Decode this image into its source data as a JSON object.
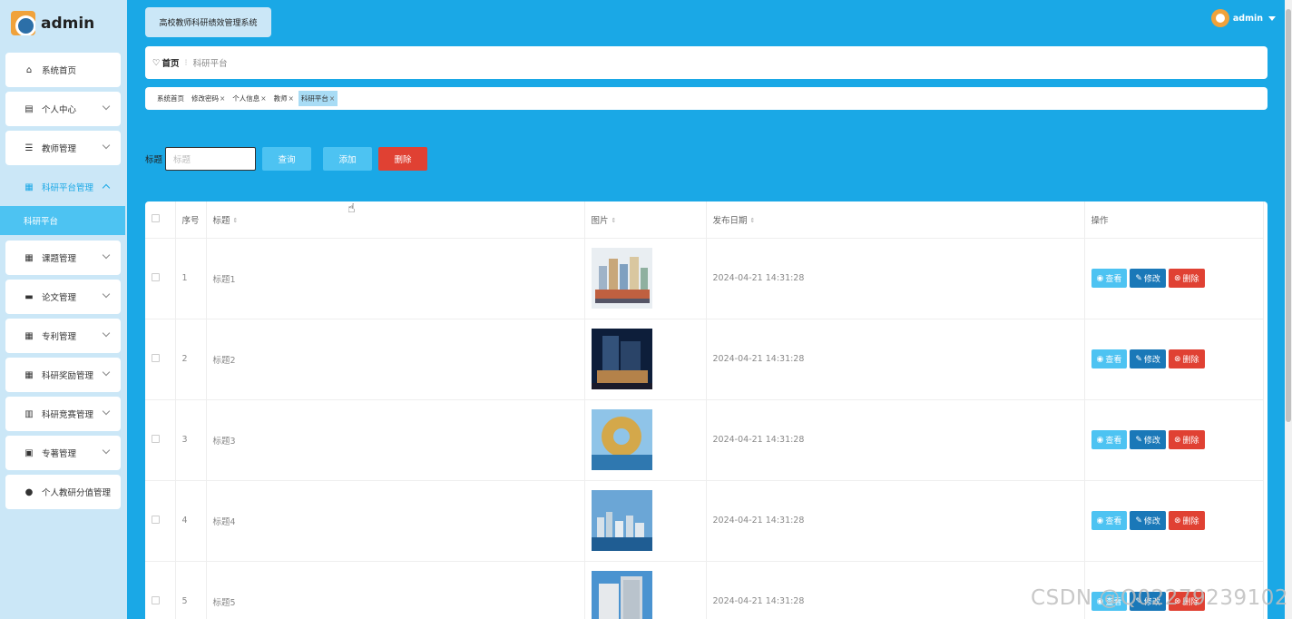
{
  "app": {
    "logo_text": "admin",
    "system_title": "高校教师科研绩效管理系统",
    "user_name": "admin"
  },
  "sidebar": {
    "items": [
      {
        "label": "系统首页",
        "icon": "home-icon",
        "glyph": "⌂",
        "expandable": false
      },
      {
        "label": "个人中心",
        "icon": "calendar-icon",
        "glyph": "▤",
        "expandable": true
      },
      {
        "label": "教师管理",
        "icon": "sliders-icon",
        "glyph": "☰",
        "expandable": true
      },
      {
        "label": "科研平台管理",
        "icon": "grid-icon",
        "glyph": "▦",
        "expandable": true,
        "expanded": true,
        "active": true
      },
      {
        "label": "课题管理",
        "icon": "grid-icon",
        "glyph": "▦",
        "expandable": true
      },
      {
        "label": "论文管理",
        "icon": "briefcase-icon",
        "glyph": "▬",
        "expandable": true
      },
      {
        "label": "专利管理",
        "icon": "grid-icon",
        "glyph": "▦",
        "expandable": true
      },
      {
        "label": "科研奖励管理",
        "icon": "grid-icon",
        "glyph": "▦",
        "expandable": true
      },
      {
        "label": "科研竞赛管理",
        "icon": "bar-chart-icon",
        "glyph": "▥",
        "expandable": true
      },
      {
        "label": "专著管理",
        "icon": "ticket-icon",
        "glyph": "▣",
        "expandable": true
      },
      {
        "label": "个人教研分值管理",
        "icon": "user-icon",
        "glyph": "●",
        "expandable": false
      }
    ],
    "submenu_label": "科研平台"
  },
  "breadcrumb": {
    "home": "首页",
    "separator": "/",
    "current": "科研平台"
  },
  "tags": [
    {
      "label": "系统首页",
      "closable": false,
      "active": false
    },
    {
      "label": "修改密码",
      "closable": true,
      "active": false
    },
    {
      "label": "个人信息",
      "closable": true,
      "active": false
    },
    {
      "label": "教师",
      "closable": true,
      "active": false
    },
    {
      "label": "科研平台",
      "closable": true,
      "active": true
    }
  ],
  "search": {
    "label": "标题",
    "placeholder": "标题",
    "query_label": "查询",
    "add_label": "添加",
    "delete_label": "删除"
  },
  "table": {
    "headers": {
      "index": "序号",
      "title": "标题",
      "image": "图片",
      "date": "发布日期",
      "ops": "操作"
    },
    "rows": [
      {
        "index": "1",
        "title": "标题1",
        "date": "2024-04-21 14:31:28",
        "image": "city-buildings-image"
      },
      {
        "index": "2",
        "title": "标题2",
        "date": "2024-04-21 14:31:28",
        "image": "night-tower-image"
      },
      {
        "index": "3",
        "title": "标题3",
        "date": "2024-04-21 14:31:28",
        "image": "ring-building-image"
      },
      {
        "index": "4",
        "title": "标题4",
        "date": "2024-04-21 14:31:28",
        "image": "waterfront-skyline-image"
      },
      {
        "index": "5",
        "title": "标题5",
        "date": "2024-04-21 14:31:28",
        "image": "office-building-image"
      }
    ],
    "op_labels": {
      "view": "查看",
      "edit": "修改",
      "delete": "删除"
    }
  },
  "watermark": "CSDN @Q02279239102",
  "colors": {
    "primary": "#1aa8e6",
    "sidebar_bg": "#cbe7f7",
    "light_btn": "#4dc3f2",
    "edit_btn": "#1a78b8",
    "danger": "#e04133"
  }
}
